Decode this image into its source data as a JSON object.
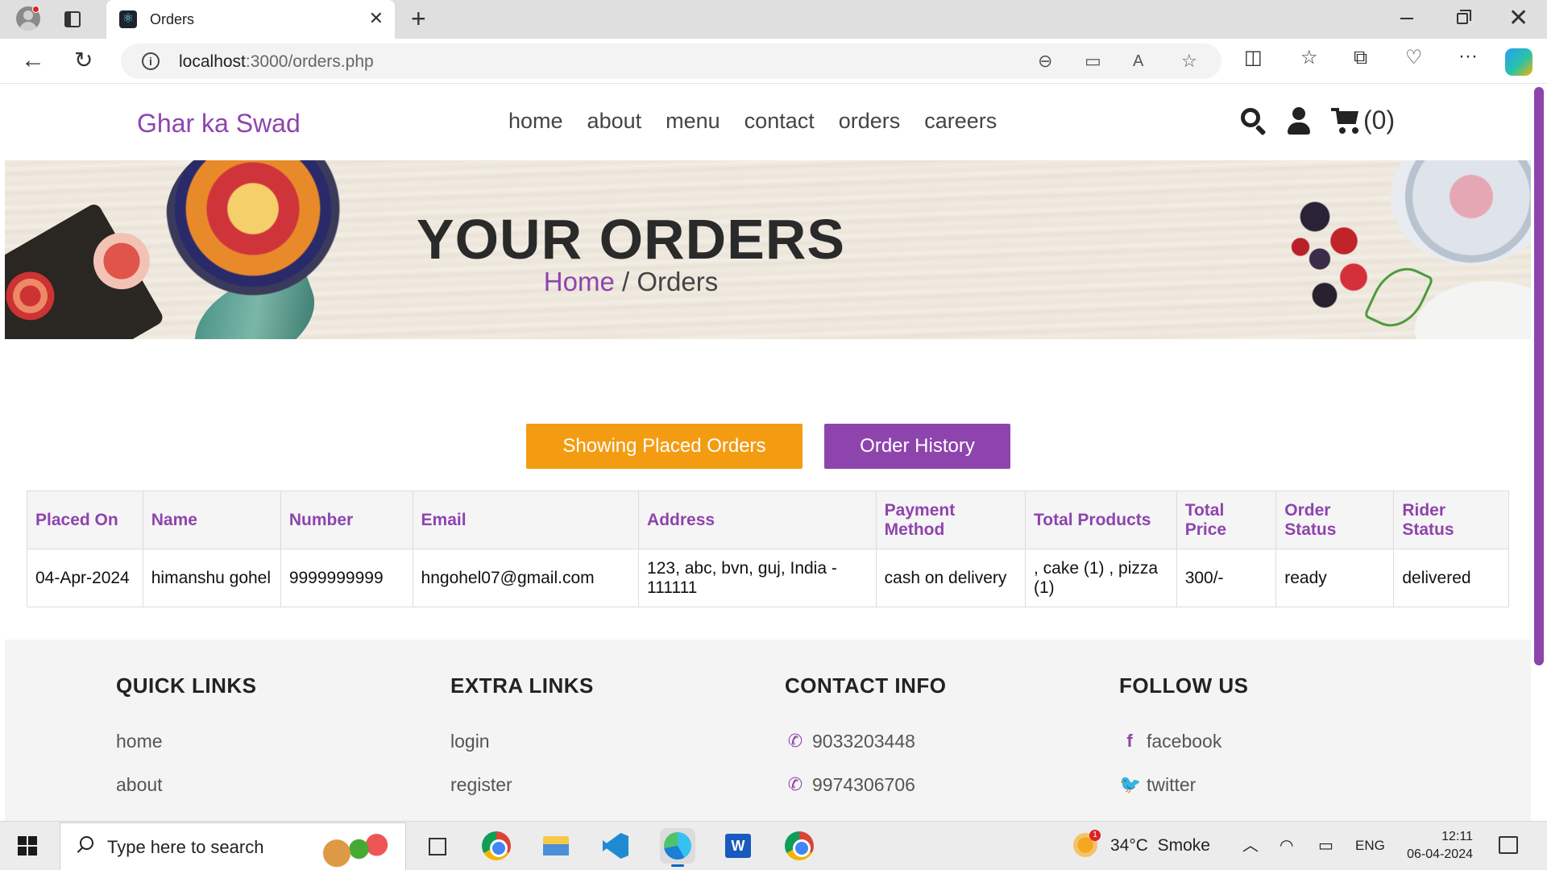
{
  "browser": {
    "tab_title": "Orders",
    "url_host": "localhost",
    "url_rest": ":3000/orders.php"
  },
  "site": {
    "logo": "Ghar ka Swad",
    "nav": [
      "home",
      "about",
      "menu",
      "contact",
      "orders",
      "careers"
    ],
    "cart_count": "(0)"
  },
  "hero": {
    "title": "YOUR ORDERS",
    "crumb_home": "Home",
    "crumb_sep": " / ",
    "crumb_current": "Orders"
  },
  "buttons": {
    "placed": "Showing Placed Orders",
    "history": "Order History"
  },
  "table": {
    "headers": [
      "Placed On",
      "Name",
      "Number",
      "Email",
      "Address",
      "Payment Method",
      "Total Products",
      "Total Price",
      "Order Status",
      "Rider Status"
    ],
    "rows": [
      [
        "04-Apr-2024",
        "himanshu gohel",
        "9999999999",
        "hngohel07@gmail.com",
        "123, abc, bvn, guj, India - 111111",
        "cash on delivery",
        ", cake (1) , pizza (1)",
        "300/-",
        "ready",
        "delivered"
      ]
    ]
  },
  "footer": {
    "quick_links": {
      "title": "QUICK LINKS",
      "items": [
        "home",
        "about"
      ]
    },
    "extra_links": {
      "title": "EXTRA LINKS",
      "items": [
        "login",
        "register"
      ]
    },
    "contact_info": {
      "title": "CONTACT INFO",
      "items": [
        "9033203448",
        "9974306706"
      ]
    },
    "follow_us": {
      "title": "FOLLOW US",
      "items": [
        "facebook",
        "twitter"
      ]
    }
  },
  "taskbar": {
    "search_placeholder": "Type here to search",
    "weather": "34°C  Smoke",
    "weather_badge": "1",
    "lang": "ENG",
    "time": "12:11",
    "date": "06-04-2024"
  },
  "colors": {
    "accent": "#8e44ad",
    "orange": "#f39c12"
  }
}
